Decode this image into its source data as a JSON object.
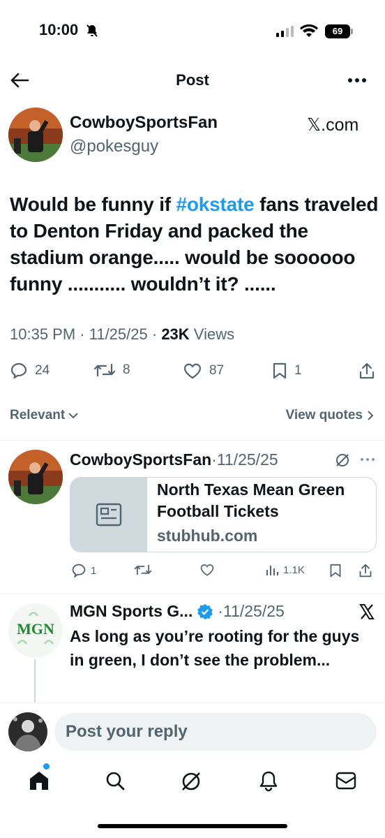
{
  "status_bar": {
    "time": "10:00",
    "battery": "69"
  },
  "header": {
    "title": "Post"
  },
  "post": {
    "author_name": "CowboySportsFan",
    "author_handle": "@pokesguy",
    "source_label": "𝕏.com",
    "text_before": "Would be funny if ",
    "hashtag": "#okstate",
    "text_after": " fans traveled to Denton Friday and packed the stadium orange..... would be soooooo funny ........... wouldn’t it? ......",
    "time": "10:35 PM",
    "date": "11/25/25",
    "views_count": "23K",
    "views_label": "Views",
    "replies": "24",
    "reposts": "8",
    "likes": "87",
    "bookmarks": "1"
  },
  "sort": {
    "label": "Relevant",
    "view_quotes": "View quotes"
  },
  "replies": [
    {
      "author_name": "CowboySportsFan",
      "date": "·11/25/25",
      "card_title": "North Texas Mean Green Football Tickets",
      "card_domain": "stubhub.com",
      "reply_count": "1",
      "views": "1.1K"
    },
    {
      "author_name": "MGN Sports G...",
      "date": "·11/25/25",
      "text": "As long as you’re rooting for the guys in green, I don’t see the problem...",
      "logo_text": "MGN"
    }
  ],
  "composer": {
    "placeholder": "Post your reply"
  },
  "colors": {
    "accent": "#1d9bf0",
    "secondary_text": "#536471"
  }
}
